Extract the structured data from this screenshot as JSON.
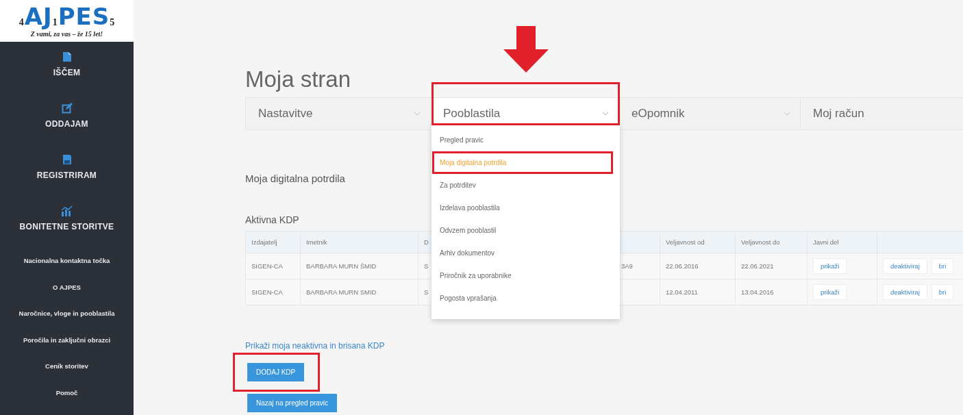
{
  "logo": {
    "parts": [
      {
        "text": "4",
        "kind": "digit"
      },
      {
        "text": "A",
        "kind": "letter"
      },
      {
        "text": "J",
        "kind": "letter"
      },
      {
        "text": "1",
        "kind": "digit"
      },
      {
        "text": "P",
        "kind": "letter"
      },
      {
        "text": "E",
        "kind": "letter"
      },
      {
        "text": "S",
        "kind": "letter"
      },
      {
        "text": "5",
        "kind": "digit"
      }
    ],
    "tagline": "Z vami, za vas – že 15 let!"
  },
  "sidebar": {
    "items": [
      {
        "label": "IŠČEM",
        "kind": "icon"
      },
      {
        "label": "ODDAJAM",
        "kind": "icon"
      },
      {
        "label": "REGISTRIRAM",
        "kind": "icon"
      },
      {
        "label": "BONITETNE STORITVE",
        "kind": "icon"
      },
      {
        "label": "Nacionalna kontaktna točka",
        "kind": "link"
      },
      {
        "label": "O AJPES",
        "kind": "link"
      },
      {
        "label": "Naročnice, vloge in pooblastila",
        "kind": "link"
      },
      {
        "label": "Poročila in zaključni obrazci",
        "kind": "link"
      },
      {
        "label": "Cenik storitev",
        "kind": "link"
      },
      {
        "label": "Pomoč",
        "kind": "link"
      }
    ]
  },
  "page_title": "Moja stran",
  "tabs": [
    {
      "label": "Nastavitve",
      "selected": false,
      "chevron": true
    },
    {
      "label": "Pooblastila",
      "selected": true,
      "chevron": true
    },
    {
      "label": "eOpomnik",
      "selected": false,
      "chevron": true
    },
    {
      "label": "Moj račun",
      "selected": false,
      "chevron": false
    }
  ],
  "dropdown": {
    "items": [
      {
        "label": "Pregled pravic",
        "selected": false
      },
      {
        "label": "Moja digitalna potrdila",
        "selected": true
      },
      {
        "label": "Za potrditev",
        "selected": false
      },
      {
        "label": "Izdelava pooblastila",
        "selected": false
      },
      {
        "label": "Odvzem pooblastil",
        "selected": false
      },
      {
        "label": "Arhiv dokumentov",
        "selected": false
      },
      {
        "label": "Priročnik za uporabnike",
        "selected": false
      },
      {
        "label": "Pogosta vprašanja",
        "selected": false
      }
    ]
  },
  "section_title": "Moja digitalna potrdila",
  "table": {
    "title": "Aktivna KDP",
    "columns": [
      "Izdajatelj",
      "Imetnik",
      "D",
      null,
      "Veljavnost od",
      "Veljavnost do",
      "Javni del",
      null
    ],
    "rows": [
      {
        "cells": [
          "SIGEN-CA",
          "BARBARA MURN ŠMID",
          "S",
          "3A9",
          "22.06.2016",
          "22.06.2021"
        ],
        "show_button": "prikaži",
        "actions": [
          "deaktiviraj",
          "bri"
        ]
      },
      {
        "cells": [
          "SIGEN-CA",
          "BARBARA MURN SMID",
          "S",
          null,
          "12.04.2011",
          "13.04.2016"
        ],
        "show_button": "prikaži",
        "actions": [
          "deaktiviraj",
          "bri"
        ]
      }
    ]
  },
  "link": "Prikaži moja neaktivna in brisana KDP",
  "buttons": [
    {
      "label": "DODAJ KDP",
      "highlighted": true
    },
    {
      "label": "Nazaj na pregled pravic",
      "highlighted": false
    }
  ],
  "annotations": {
    "arrow": true,
    "tab_frame": true,
    "item_frame": true
  }
}
